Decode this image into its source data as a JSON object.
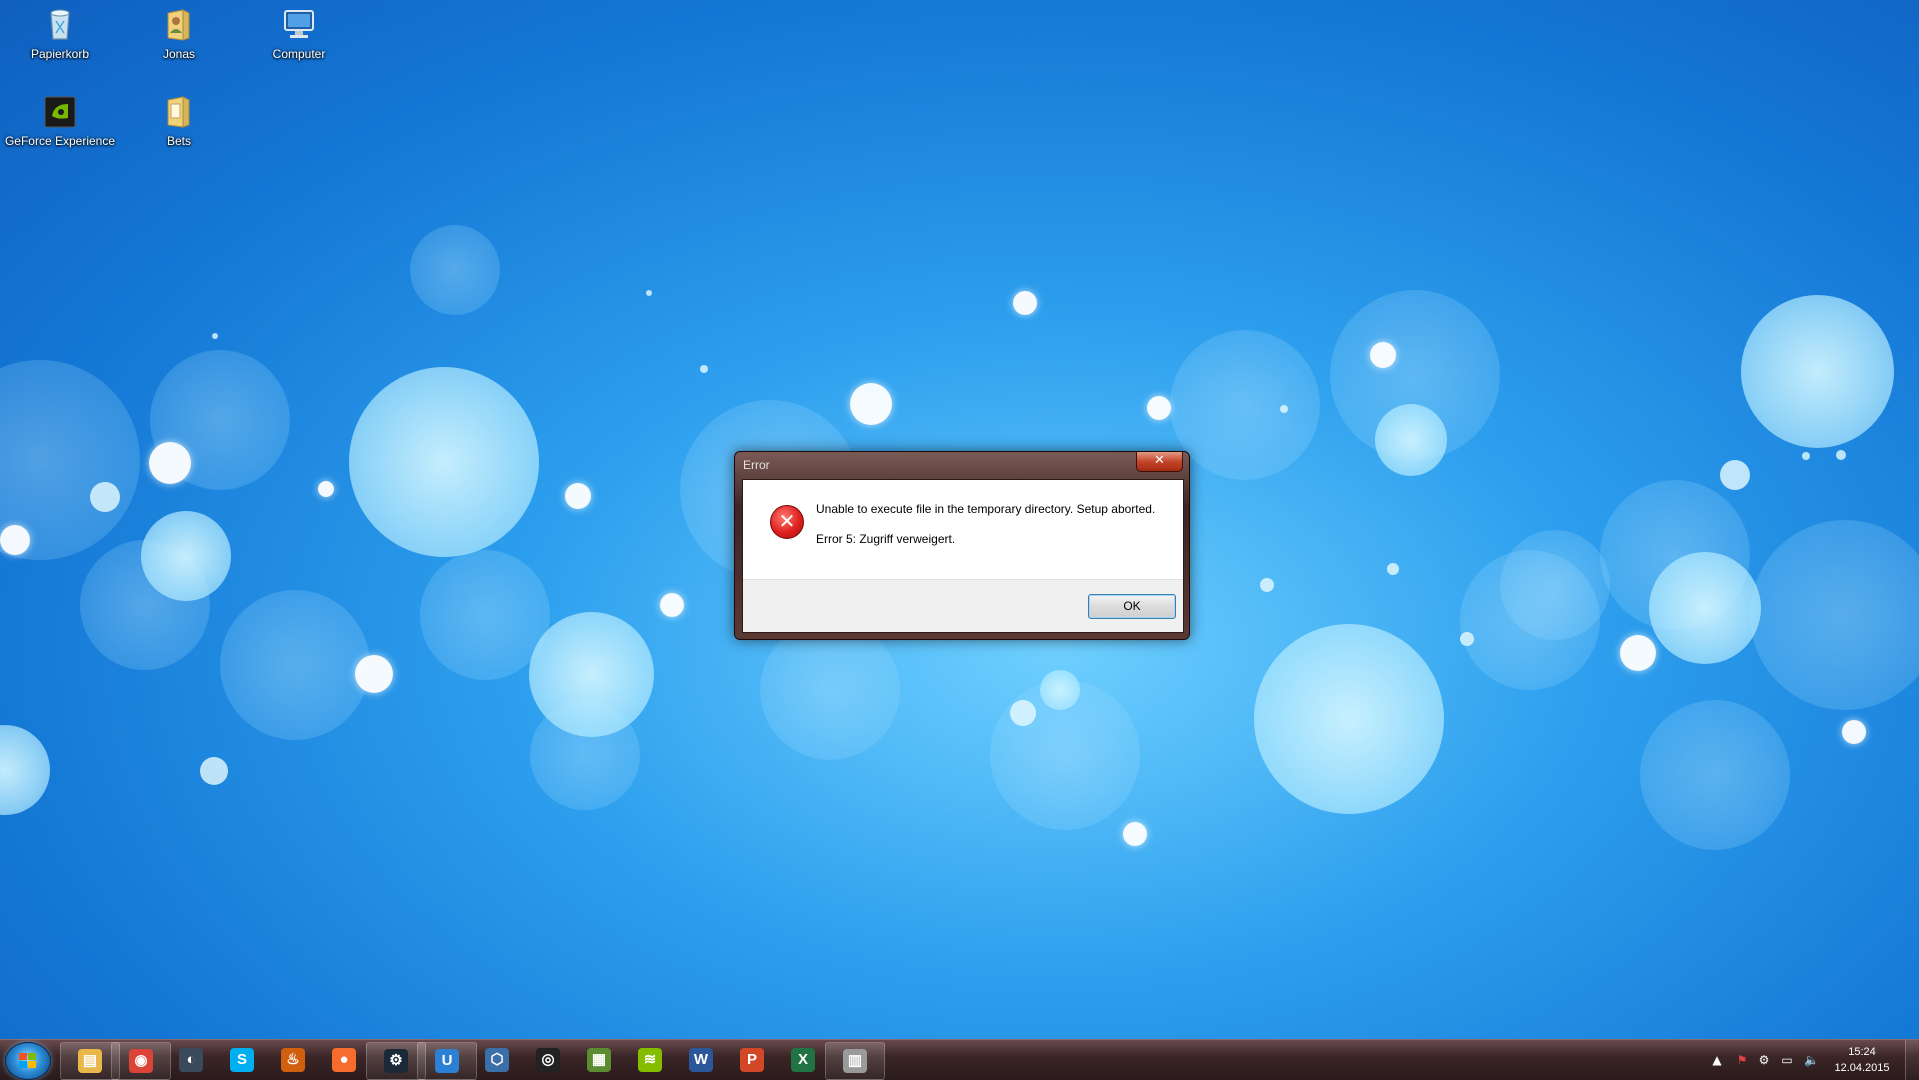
{
  "desktop": {
    "icons": [
      {
        "label": "Papierkorb",
        "icon": "recycle-bin-icon"
      },
      {
        "label": "Jonas",
        "icon": "user-folder-icon"
      },
      {
        "label": "Computer",
        "icon": "computer-icon"
      },
      {
        "label": "GeForce Experience",
        "icon": "geforce-icon"
      },
      {
        "label": "Bets",
        "icon": "folder-icon"
      }
    ]
  },
  "dialog": {
    "title": "Error",
    "close_label": "✕",
    "message": "Unable to execute file in the temporary directory. Setup aborted.",
    "detail": "Error 5: Zugriff verweigert.",
    "ok_label": "OK",
    "icon": "error-icon"
  },
  "taskbar": {
    "pinned": [
      {
        "name": "windows-explorer",
        "glyph": "▤",
        "color": "#e8b84a",
        "open": true
      },
      {
        "name": "chrome",
        "glyph": "◉",
        "color": "#db4437",
        "open": true
      },
      {
        "name": "teamspeak",
        "glyph": "◐",
        "color": "#3a4a5a",
        "open": false
      },
      {
        "name": "skype",
        "glyph": "S",
        "color": "#00aff0",
        "open": false
      },
      {
        "name": "firestorm",
        "glyph": "♨",
        "color": "#d06010",
        "open": false
      },
      {
        "name": "origin",
        "glyph": "●",
        "color": "#f56c2d",
        "open": false
      },
      {
        "name": "steam",
        "glyph": "⚙",
        "color": "#1b2838",
        "open": true
      },
      {
        "name": "uplay",
        "glyph": "U",
        "color": "#2b7fd4",
        "open": true
      },
      {
        "name": "hearthstone",
        "glyph": "⬡",
        "color": "#3a6fa8",
        "open": false
      },
      {
        "name": "obs",
        "glyph": "◎",
        "color": "#222222",
        "open": false
      },
      {
        "name": "minecraft",
        "glyph": "▦",
        "color": "#5b8c32",
        "open": false
      },
      {
        "name": "spotify",
        "glyph": "≋",
        "color": "#84bd00",
        "open": false
      },
      {
        "name": "word",
        "glyph": "W",
        "color": "#2b579a",
        "open": false
      },
      {
        "name": "powerpoint",
        "glyph": "P",
        "color": "#d24726",
        "open": false
      },
      {
        "name": "excel",
        "glyph": "X",
        "color": "#217346",
        "open": false
      },
      {
        "name": "setup",
        "glyph": "▥",
        "color": "#9a9a9a",
        "open": true
      }
    ],
    "tray": [
      "chevron-up-icon",
      "flag-icon",
      "steam-tray-icon",
      "network-icon",
      "volume-icon"
    ],
    "clock": {
      "time": "15:24",
      "date": "12.04.2015"
    }
  },
  "colors": {
    "wallpaper": "#1d8be0",
    "taskbar": "#3b2627",
    "dialog_frame": "#4a2f2c"
  }
}
